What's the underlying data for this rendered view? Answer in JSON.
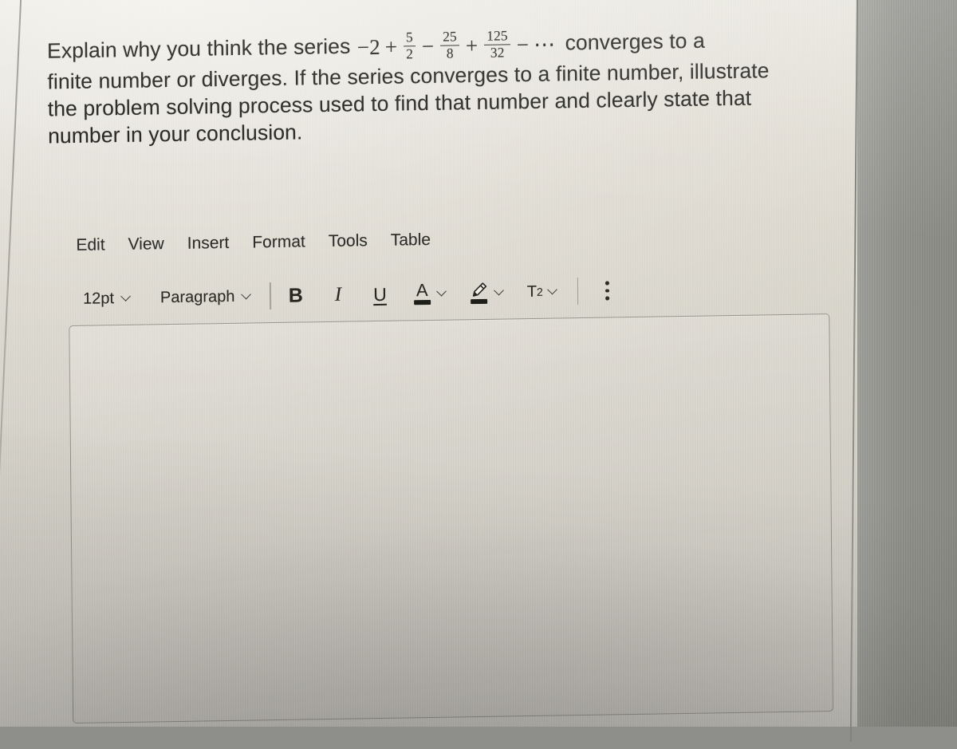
{
  "question": {
    "line1_before_math": "Explain why you think the series",
    "math": {
      "leading_sign": "−2",
      "terms": [
        {
          "op": "+",
          "numerator": "5",
          "denominator": "2"
        },
        {
          "op": "−",
          "numerator": "25",
          "denominator": "8"
        },
        {
          "op": "+",
          "numerator": "125",
          "denominator": "32"
        }
      ],
      "trailing_op": "−",
      "ellipsis": "⋯",
      "plain_text": "−2 + 5/2 − 25/8 + 125/32 − ..."
    },
    "line1_after_math": "converges to a",
    "line2": "finite number or diverges.  If the series converges to a finite number, illustrate",
    "line3": "the problem solving process used to find that number and clearly state that",
    "line4": "number in your conclusion."
  },
  "editor": {
    "menubar": [
      {
        "label": "Edit"
      },
      {
        "label": "View"
      },
      {
        "label": "Insert"
      },
      {
        "label": "Format"
      },
      {
        "label": "Tools"
      },
      {
        "label": "Table"
      }
    ],
    "toolbar": {
      "font_size": {
        "value": "12pt",
        "icon": "chevron-down-icon"
      },
      "block_format": {
        "value": "Paragraph",
        "icon": "chevron-down-icon"
      },
      "bold": {
        "label": "B",
        "icon": "bold-icon"
      },
      "italic": {
        "label": "I",
        "icon": "italic-icon"
      },
      "underline": {
        "label": "U",
        "icon": "underline-icon"
      },
      "text_color": {
        "label": "A",
        "icon": "text-color-icon",
        "swatch": "#1d1d18"
      },
      "highlight_color": {
        "icon": "highlighter-pen-icon",
        "swatch": "#1d1d18"
      },
      "superscript": {
        "label": "T",
        "exponent": "2",
        "icon": "superscript-icon"
      },
      "more_options": {
        "icon": "kebab-menu-icon"
      }
    },
    "body_placeholder": ""
  },
  "colors": {
    "screen_background": "#d8d6cd",
    "bezel": "#8e8e8a",
    "text": "#23231f",
    "border": "#7d7d73"
  }
}
